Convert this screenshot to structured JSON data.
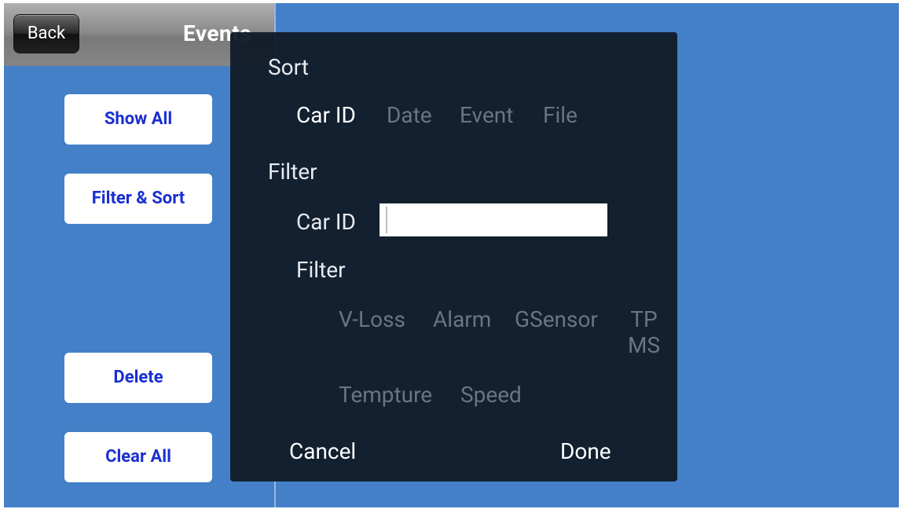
{
  "header": {
    "back_label": "Back",
    "title": "Events"
  },
  "sidebar": {
    "show_all": "Show All",
    "filter_sort": "Filter & Sort",
    "delete": "Delete",
    "clear_all": "Clear All"
  },
  "dialog": {
    "sort_heading": "Sort",
    "sort_options": [
      "Car ID",
      "Date",
      "Event",
      "File"
    ],
    "sort_selected": "Car ID",
    "filter_heading": "Filter",
    "car_id_label": "Car ID",
    "car_id_value": "",
    "filter_label": "Filter",
    "filter_options": [
      "V-Loss",
      "Alarm",
      "GSensor",
      "TP\nMS",
      "Tempture",
      "Speed"
    ],
    "cancel_label": "Cancel",
    "done_label": "Done"
  }
}
